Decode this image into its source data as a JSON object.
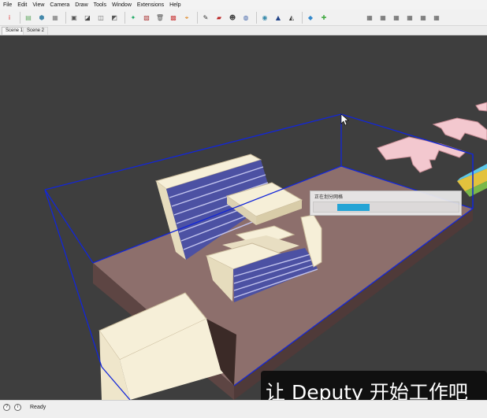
{
  "menu": [
    "File",
    "Edit",
    "View",
    "Camera",
    "Draw",
    "Tools",
    "Window",
    "Extensions",
    "Help"
  ],
  "tabs": [
    "Scene 1",
    "Scene 2"
  ],
  "toolbar_icons": [
    {
      "name": "instructor-icon",
      "glyph": "i",
      "color": "#d22"
    },
    {
      "name": "get-models-icon",
      "glyph": "▤",
      "color": "#6a6"
    },
    {
      "name": "share-model-icon",
      "glyph": "⬢",
      "color": "#48a"
    },
    {
      "name": "layers-icon",
      "glyph": "▦",
      "color": "#777"
    },
    {
      "name": "ruby-console-icon",
      "glyph": "▣",
      "color": "#555"
    },
    {
      "name": "model-info-icon",
      "glyph": "◪",
      "color": "#444"
    },
    {
      "name": "components-icon",
      "glyph": "◫",
      "color": "#666"
    },
    {
      "name": "materials-icon",
      "glyph": "◩",
      "color": "#555"
    },
    {
      "name": "star-icon",
      "glyph": "✦",
      "color": "#2a6"
    },
    {
      "name": "report-icon",
      "glyph": "▧",
      "color": "#a33"
    },
    {
      "name": "trash-icon",
      "glyph": "🗑",
      "color": "#555"
    },
    {
      "name": "box-icon",
      "glyph": "▩",
      "color": "#c44"
    },
    {
      "name": "map-pin-icon",
      "glyph": "⌖",
      "color": "#d70"
    },
    {
      "name": "pencil-icon",
      "glyph": "✎",
      "color": "#333"
    },
    {
      "name": "paint-icon",
      "glyph": "▰",
      "color": "#b22"
    },
    {
      "name": "walk-icon",
      "glyph": "☻",
      "color": "#444"
    },
    {
      "name": "section-icon",
      "glyph": "◍",
      "color": "#46a"
    },
    {
      "name": "globe-icon",
      "glyph": "◉",
      "color": "#38a"
    },
    {
      "name": "sandbox-icon",
      "glyph": "▲",
      "color": "#248"
    },
    {
      "name": "shadow-icon",
      "glyph": "◭",
      "color": "#333"
    },
    {
      "name": "warehouse-icon",
      "glyph": "◆",
      "color": "#38c"
    },
    {
      "name": "extension-icon",
      "glyph": "✚",
      "color": "#4a4"
    },
    {
      "name": "view-iso-icon",
      "glyph": "▦",
      "color": "#555"
    },
    {
      "name": "view-top-icon",
      "glyph": "▦",
      "color": "#555"
    },
    {
      "name": "view-front-icon",
      "glyph": "▦",
      "color": "#555"
    },
    {
      "name": "view-right-icon",
      "glyph": "▦",
      "color": "#555"
    },
    {
      "name": "view-back-icon",
      "glyph": "▦",
      "color": "#555"
    },
    {
      "name": "view-left-icon",
      "glyph": "▦",
      "color": "#555"
    }
  ],
  "progress": {
    "title": "正在划分网格",
    "value": 0.22,
    "color": "#1ea9de"
  },
  "subtitle": "让 Deputy 开始工作吧",
  "status": {
    "text": "Ready",
    "icons": [
      "help-icon",
      "info-icon"
    ]
  },
  "colors": {
    "viewport_bg": "#3e3e3e",
    "ground": "#8d6f6c",
    "building": "#f6efd8",
    "selection": "#1226d9",
    "accent": "#1ea9de"
  }
}
